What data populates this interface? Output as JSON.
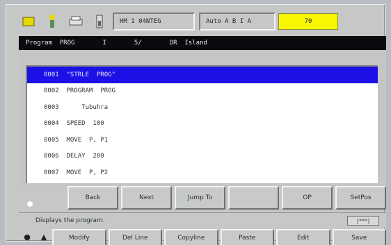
{
  "status": {
    "icons": [
      "bulb-icon",
      "robot-icon",
      "printer-icon",
      "battery-icon"
    ],
    "mode_label": "HM  1  04NTEG",
    "motor_label": "Auto  A B I A",
    "speed_value": "70",
    "speed_color": "#f8f600"
  },
  "title": {
    "program": "Program  PROG",
    "field2": "I",
    "field3": "5/",
    "field4": "DR  Island"
  },
  "program_lines": [
    "0001  \"STRLE  PROG\"",
    "0002  PROGRAM  PROG",
    "0003      Tubuhra",
    "0004  SPEED  100",
    "0005  MOVE  P, P1",
    "0006  DELAY  200",
    "0007  MOVE  P, P2"
  ],
  "selected_line": 0,
  "fkeys": [
    "Back",
    "Next",
    "Jump To",
    "",
    "OP",
    "SetPos"
  ],
  "message": "Displays the program.",
  "message_box": "[***]",
  "bottom_keys": [
    "Modify",
    "Del Line",
    "Copyline",
    "Paste",
    "Edit",
    "Save"
  ],
  "bottom_icons": [
    "stop-icon",
    "triangle-icon"
  ]
}
